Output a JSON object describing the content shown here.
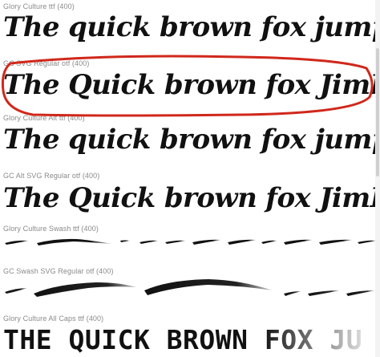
{
  "fonts": [
    {
      "label": "Glory Culture ttf (400)",
      "sample": "The quick brown fox jumps over the la"
    },
    {
      "label": "GC SVG Regular otf (400)",
      "sample": "The Quick brown fox JimPs over the la"
    },
    {
      "label": "Glory Culture Alt ttf (400)",
      "sample": "The quick brown fox jumps over the la"
    },
    {
      "label": "GC Alt SVG Regular otf (400)",
      "sample": "The Quick brown fox JimPs over the la"
    },
    {
      "label": "Glory Culture Swash ttf (400)"
    },
    {
      "label": "GC Swash SVG Regular otf (400)"
    },
    {
      "label": "Glory Culture All Caps ttf (400)",
      "sample": "THE QUICK BROWN FOX JU"
    }
  ],
  "highlight_color": "#d0281b"
}
